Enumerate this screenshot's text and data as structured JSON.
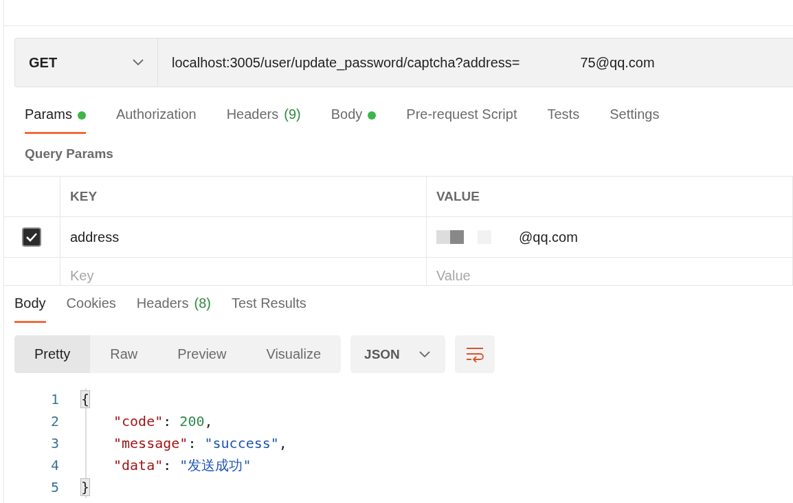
{
  "request": {
    "method": "GET",
    "url": "localhost:3005/user/update_password/captcha?address=",
    "url_tail": "75@qq.com"
  },
  "request_tabs": [
    {
      "label": "Params",
      "dot": true,
      "selected": true
    },
    {
      "label": "Authorization",
      "dot": false,
      "selected": false
    },
    {
      "label": "Headers",
      "count": "(9)",
      "dot": false,
      "selected": false
    },
    {
      "label": "Body",
      "dot": true,
      "selected": false
    },
    {
      "label": "Pre-request Script",
      "dot": false,
      "selected": false
    },
    {
      "label": "Tests",
      "dot": false,
      "selected": false
    },
    {
      "label": "Settings",
      "dot": false,
      "selected": false
    }
  ],
  "section_title": "Query Params",
  "params_table": {
    "columns": [
      "KEY",
      "VALUE"
    ],
    "rows": [
      {
        "checked": true,
        "key": "address",
        "value": "@qq.com"
      }
    ],
    "new_row": {
      "key_placeholder": "Key",
      "value_placeholder": "Value"
    }
  },
  "response_tabs": [
    {
      "label": "Body",
      "selected": true
    },
    {
      "label": "Cookies",
      "selected": false
    },
    {
      "label": "Headers",
      "count": "(8)",
      "selected": false
    },
    {
      "label": "Test Results",
      "selected": false
    }
  ],
  "view_modes": [
    {
      "label": "Pretty",
      "selected": true
    },
    {
      "label": "Raw",
      "selected": false
    },
    {
      "label": "Preview",
      "selected": false
    },
    {
      "label": "Visualize",
      "selected": false
    }
  ],
  "format": "JSON",
  "code_lines": [
    {
      "number": "1",
      "tokens": [
        {
          "kind": "brace",
          "text": "{"
        }
      ]
    },
    {
      "number": "2",
      "tokens": [
        {
          "kind": "key",
          "text": "\"code\""
        },
        {
          "kind": "punct",
          "text": ": "
        },
        {
          "kind": "number",
          "text": "200"
        },
        {
          "kind": "punct",
          "text": ","
        }
      ]
    },
    {
      "number": "3",
      "tokens": [
        {
          "kind": "key",
          "text": "\"message\""
        },
        {
          "kind": "punct",
          "text": ": "
        },
        {
          "kind": "string",
          "text": "\"success\""
        },
        {
          "kind": "punct",
          "text": ","
        }
      ]
    },
    {
      "number": "4",
      "tokens": [
        {
          "kind": "key",
          "text": "\"data\""
        },
        {
          "kind": "punct",
          "text": ": "
        },
        {
          "kind": "string",
          "text": "\"发送成功\""
        }
      ]
    },
    {
      "number": "5",
      "tokens": [
        {
          "kind": "brace",
          "text": "}"
        }
      ]
    }
  ]
}
